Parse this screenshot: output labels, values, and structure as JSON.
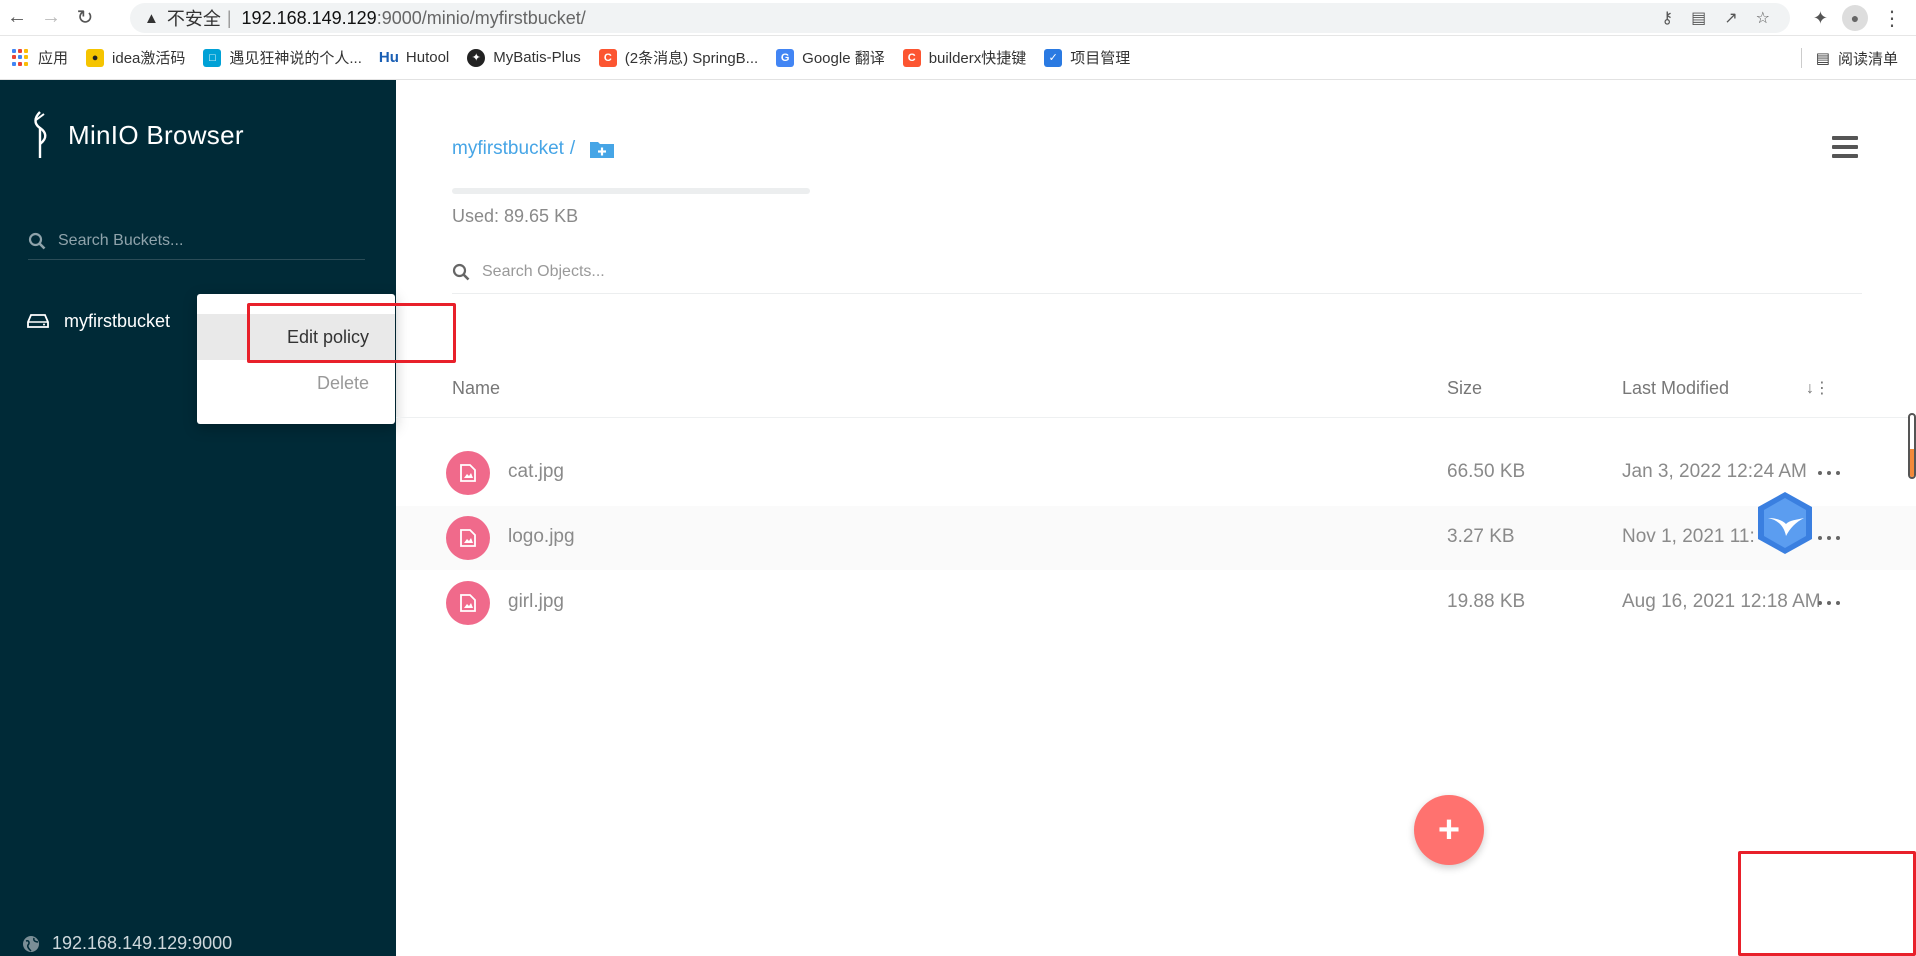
{
  "browser": {
    "insecure_label": "不安全",
    "url_host": "192.168.149.129",
    "url_path": ":9000/minio/myfirstbucket/",
    "bookmarks": [
      {
        "label": "应用"
      },
      {
        "label": "idea激活码"
      },
      {
        "label": "遇见狂神说的个人..."
      },
      {
        "label": "Hutool",
        "icon_text": "Hu"
      },
      {
        "label": "MyBatis-Plus"
      },
      {
        "label": "(2条消息) SpringB...",
        "icon_text": "C"
      },
      {
        "label": "Google 翻译"
      },
      {
        "label": "builderx快捷键",
        "icon_text": "C"
      },
      {
        "label": "项目管理"
      }
    ],
    "reading_list": "阅读清单"
  },
  "sidebar": {
    "app_title": "MinIO Browser",
    "search_placeholder": "Search Buckets...",
    "bucket_name": "myfirstbucket",
    "host": "192.168.149.129:9000"
  },
  "context_menu": {
    "edit_label": "Edit policy",
    "delete_label": "Delete"
  },
  "main": {
    "bucket_crumb": "myfirstbucket",
    "crumb_sep": "/",
    "usage_fraction": 0.0,
    "used_text": "Used: 89.65 KB",
    "object_search_placeholder": "Search Objects...",
    "columns": {
      "name": "Name",
      "size": "Size",
      "modified": "Last Modified"
    },
    "files": [
      {
        "name": "cat.jpg",
        "size": "66.50 KB",
        "modified": "Jan 3, 2022 12:24 AM"
      },
      {
        "name": "logo.jpg",
        "size": "3.27 KB",
        "modified": "Nov 1, 2021 11:"
      },
      {
        "name": "girl.jpg",
        "size": "19.88 KB",
        "modified": "Aug 16, 2021 12:18 AM"
      }
    ],
    "fab_symbol": "+"
  },
  "colors": {
    "sidebar_bg": "#002a37",
    "link_blue": "#46a5e6",
    "file_icon_pink": "#f06a8b",
    "fab_red": "#ff726f",
    "annotation_red": "#e8202a"
  },
  "icons": [
    "back-icon",
    "forward-icon",
    "reload-icon",
    "warning-icon",
    "key-icon",
    "translate-icon",
    "share-icon",
    "star-icon",
    "extensions-icon",
    "profile-icon",
    "menu-kebab-icon",
    "apps-grid-icon",
    "minio-logo-icon",
    "search-icon",
    "hard-drive-icon",
    "globe-icon",
    "folder-add-icon",
    "hamburger-icon",
    "image-file-icon",
    "more-icon",
    "sort-icon",
    "bird-badge-icon",
    "plus-icon"
  ]
}
